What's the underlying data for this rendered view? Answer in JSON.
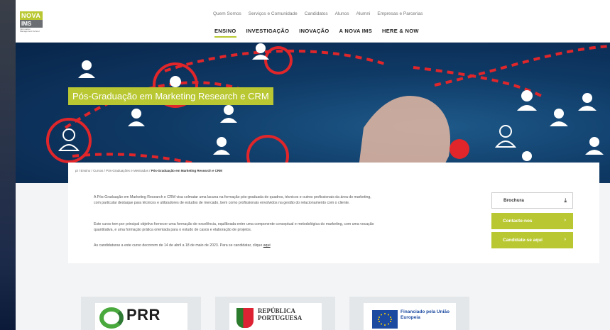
{
  "logo": {
    "nova": "NOVA",
    "ims": "IMS",
    "sub": "Information Management School"
  },
  "top_nav": [
    "Quem Somos",
    "Serviços e Comunidade",
    "Candidatos",
    "Alunos",
    "Alumni",
    "Empresas e Parcerias"
  ],
  "main_nav": [
    "ENSINO",
    "INVESTIGAÇÃO",
    "INOVAÇÃO",
    "A NOVA IMS",
    "HERE & NOW"
  ],
  "hero": {
    "title": "Pós-Graduação em Marketing Research e CRM"
  },
  "breadcrumb": {
    "items": [
      "pt",
      "Ensino",
      "Cursos",
      "Pós-Graduações e Mestrados"
    ],
    "current": "Pós-Graduação em Marketing Research e CRM"
  },
  "content": {
    "p1": "A Pós-Graduação em Marketing Research e CRM visa colmatar uma lacuna na formação pós-graduada de quadros, técnicos e outros profissionais da área do marketing, com particular destaque para técnicos e utilizadores de estudos de mercado, bem como profissionais envolvidos na gestão do relacionamento com o cliente.",
    "p2": "Este curso tem por principal objetivo fornecer uma formação de excelência, equilibrada entre uma componente conceptual e metodológica do marketing, com uma vocação quantitativa, e uma formação prática orientada para o estudo de casos e elaboração de projetos.",
    "p3_prefix": "As candidaturas a este curso decorrem de 14 de abril a 18 de maio de 2023. Para se candidatar, clique",
    "p3_link": "aqui"
  },
  "actions": {
    "brochura": "Brochura",
    "contact": "Contacte-nos",
    "apply": "Candidate-se aqui"
  },
  "funding_logos": {
    "prr": "PRR",
    "republica": "REPÚBLICA PORTUGUESA",
    "eu": "Financiado pela União Europeia"
  },
  "colors": {
    "accent": "#b9c832",
    "hero_bg": "#0f3a66",
    "eu_blue": "#1c4aa0"
  }
}
